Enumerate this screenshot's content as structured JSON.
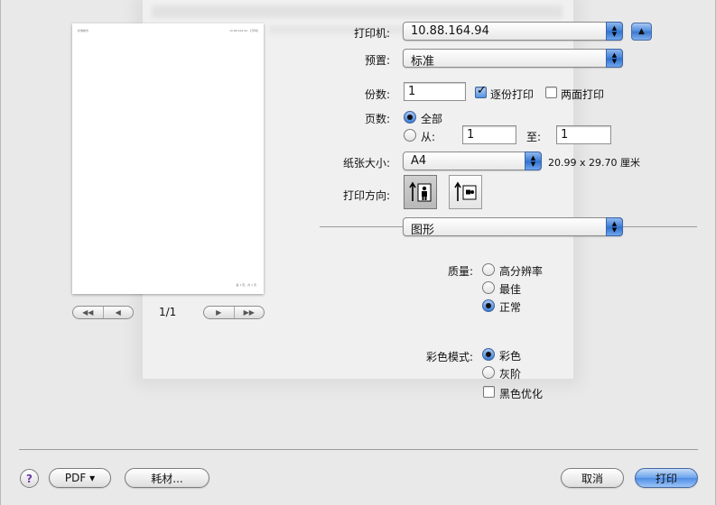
{
  "preview": {
    "header_left": "标准模式",
    "header_right": "10.88.164.94 · 打印机",
    "footer_right": "第 1 页，共 1 页",
    "page_count": "1/1",
    "nav_first": "◀◀",
    "nav_prev": "◀",
    "nav_next": "▶",
    "nav_last": "▶▶"
  },
  "printer": {
    "label": "打印机:",
    "value": "10.88.164.94"
  },
  "presets": {
    "label": "预置:",
    "value": "标准"
  },
  "copies": {
    "label": "份数:",
    "value": "1",
    "collate_label": "逐份打印",
    "collate_checked": true,
    "duplex_label": "两面打印",
    "duplex_checked": false
  },
  "pages": {
    "label": "页数:",
    "all_label": "全部",
    "from_label": "从:",
    "from_value": "1",
    "to_label": "至:",
    "to_value": "1"
  },
  "paper_size": {
    "label": "纸张大小:",
    "value": "A4",
    "dimensions": "20.99 x 29.70 厘米"
  },
  "orientation": {
    "label": "打印方向:"
  },
  "panel": {
    "value": "图形"
  },
  "quality": {
    "label": "质量:",
    "options": [
      "高分辨率",
      "最佳",
      "正常"
    ],
    "selected": 2
  },
  "color_mode": {
    "label": "彩色模式:",
    "options": [
      "彩色",
      "灰阶"
    ],
    "selected": 0,
    "black_opt_label": "黑色优化"
  },
  "footer": {
    "help": "?",
    "pdf": "PDF ▾",
    "supplies": "耗材...",
    "cancel": "取消",
    "print": "打印"
  },
  "colors": {
    "accent": "#4d8de6",
    "sheet_bg": "#e9e9e9"
  }
}
